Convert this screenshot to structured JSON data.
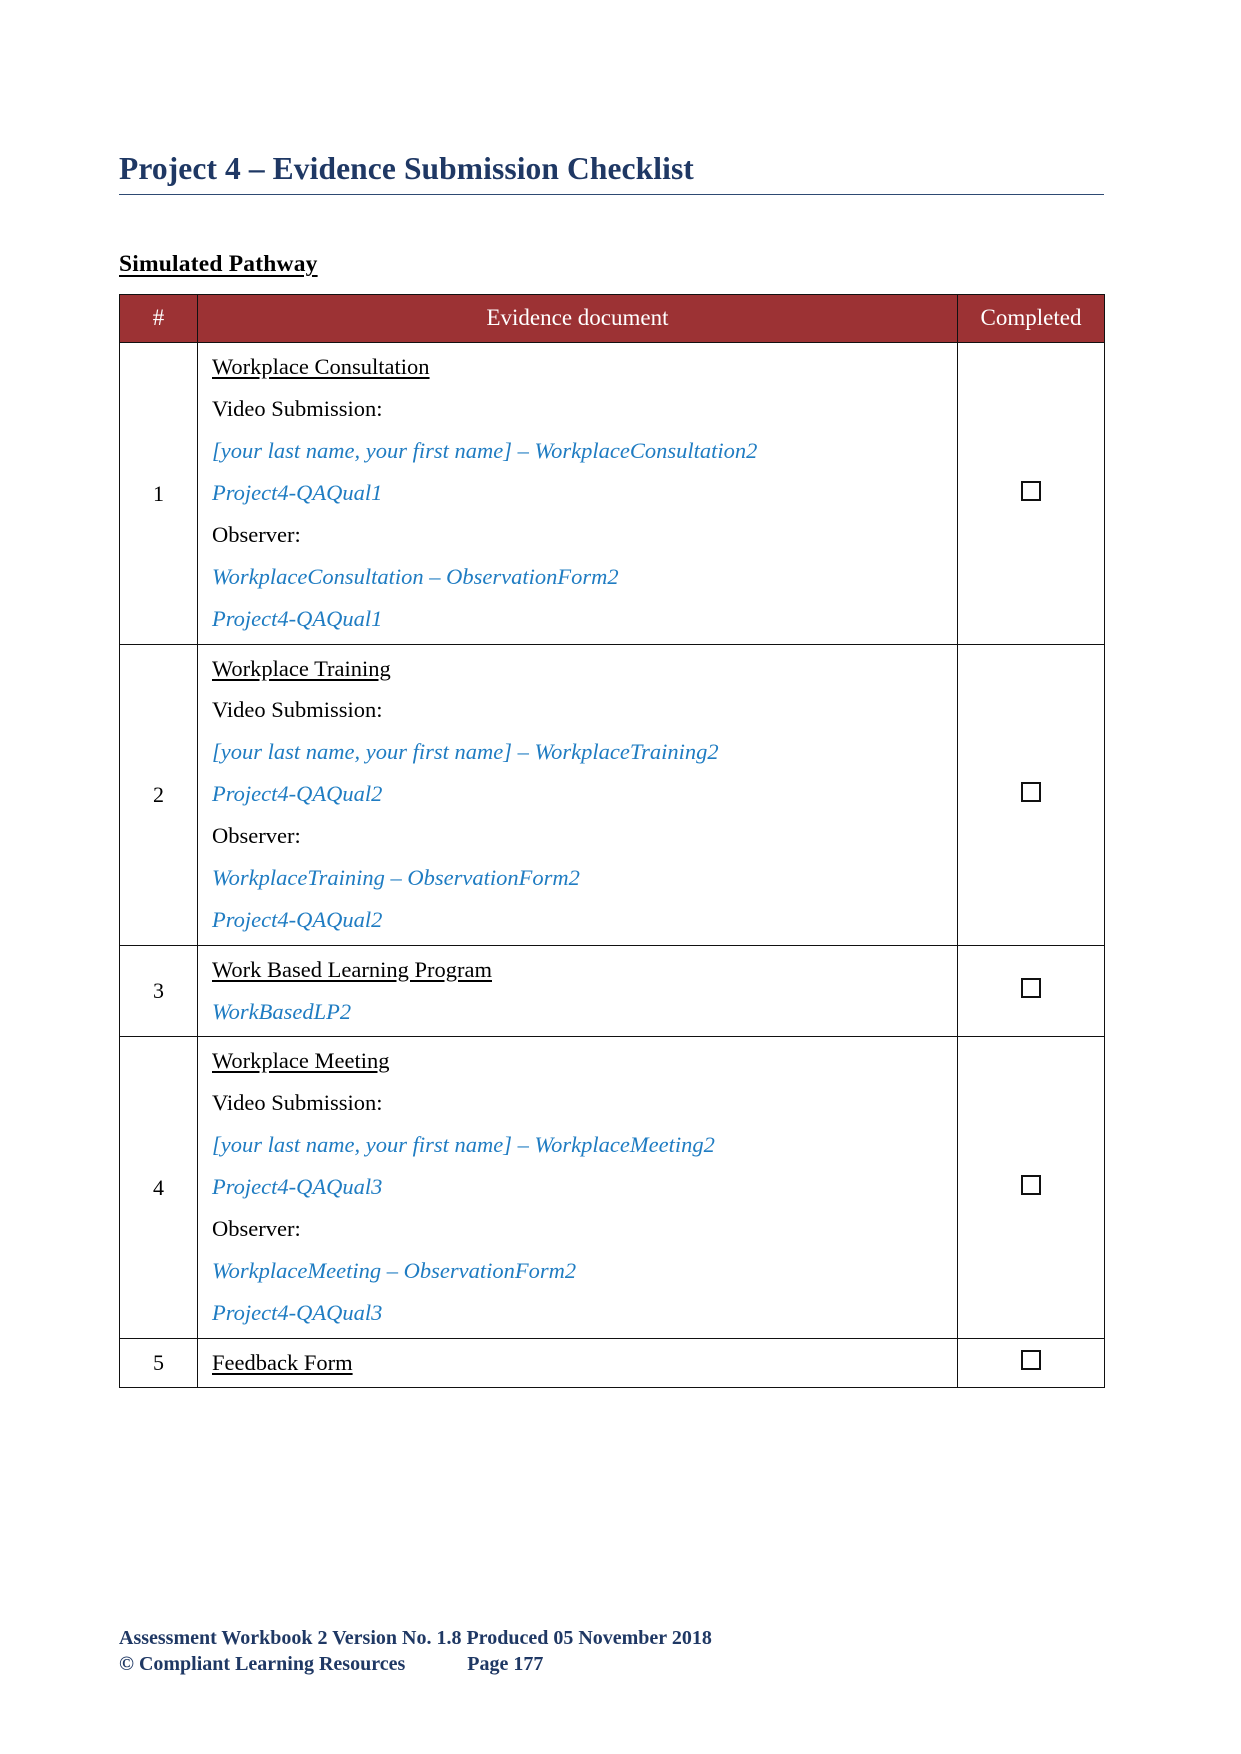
{
  "document": {
    "title": "Project 4 – Evidence Submission Checklist",
    "section_heading": "Simulated Pathway"
  },
  "table": {
    "headers": {
      "number": "#",
      "document": "Evidence document",
      "completed": "Completed"
    },
    "header_bg": "#9C3234",
    "header_text_color": "#FFFFFF",
    "blue_text_color": "#1F7CC2",
    "title_color": "#1F3864",
    "checkbox_glyph": "☐",
    "rows": [
      {
        "number": "1",
        "evidence_title": "Workplace Consultation",
        "video_label": "Video Submission:",
        "video_filename": "[your last name, your first name] – WorkplaceConsultation2",
        "video_code": "Project4-QAQual1",
        "observer_label": "Observer:",
        "observer_filename": "WorkplaceConsultation – ObservationForm2",
        "observer_code": "Project4-QAQual1",
        "completed": false
      },
      {
        "number": "2",
        "evidence_title": "Workplace Training",
        "video_label": "Video Submission:",
        "video_filename": "[your last name, your first name] – WorkplaceTraining2",
        "video_code": "Project4-QAQual2",
        "observer_label": "Observer:",
        "observer_filename": "WorkplaceTraining – ObservationForm2",
        "observer_code": "Project4-QAQual2",
        "completed": false
      },
      {
        "number": "3",
        "evidence_title": "Work Based Learning Program",
        "video_label": "",
        "video_filename": "",
        "video_code": "WorkBasedLP2",
        "observer_label": "",
        "observer_filename": "",
        "observer_code": "",
        "completed": false
      },
      {
        "number": "4",
        "evidence_title": "Workplace Meeting",
        "video_label": "Video Submission:",
        "video_filename": "[your last name, your first name] – WorkplaceMeeting2",
        "video_code": "Project4-QAQual3",
        "observer_label": "Observer:",
        "observer_filename": "WorkplaceMeeting – ObservationForm2",
        "observer_code": "Project4-QAQual3",
        "completed": false
      },
      {
        "number": "5",
        "evidence_title": "Feedback Form",
        "video_label": "",
        "video_filename": "",
        "video_code": "",
        "observer_label": "",
        "observer_filename": "",
        "observer_code": "",
        "completed": false
      }
    ]
  },
  "footer": {
    "line1": "Assessment Workbook 2 Version No. 1.8 Produced 05 November 2018",
    "copyright": "© Compliant Learning Resources",
    "page": "Page 177"
  }
}
